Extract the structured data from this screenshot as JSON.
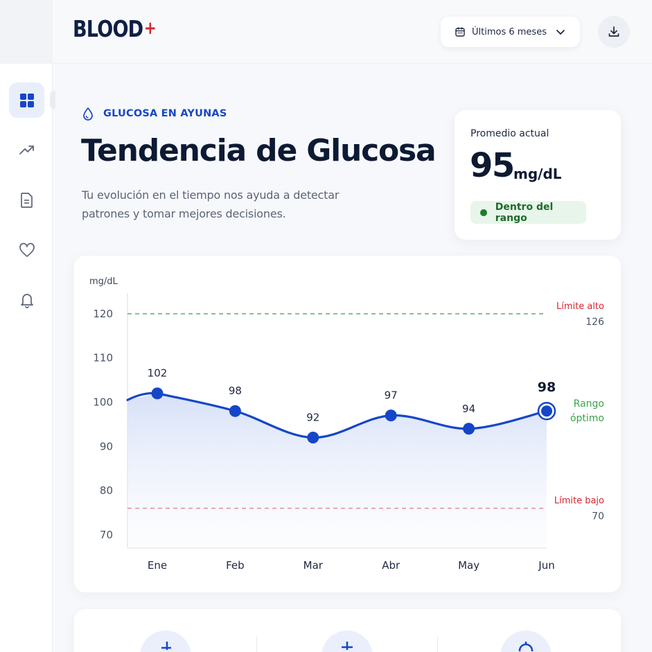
{
  "brand": {
    "logo_text": "BLOOD",
    "logo_plus": "+",
    "accent": "#d7262b",
    "navy": "#0f1f45"
  },
  "header": {
    "period_label": "Últimos 6 meses",
    "period_icon": "calendar-icon",
    "download_icon": "download-icon"
  },
  "sidebar": {
    "items": [
      {
        "name": "dashboard",
        "icon": "grid-icon",
        "active": true
      },
      {
        "name": "trends",
        "icon": "trend-up-icon",
        "active": false
      },
      {
        "name": "reports",
        "icon": "document-icon",
        "active": false
      },
      {
        "name": "health",
        "icon": "heart-icon",
        "active": false
      },
      {
        "name": "notifications",
        "icon": "bell-icon",
        "active": false
      }
    ]
  },
  "main": {
    "eyebrow": "GLUCOSA EN AYUNAS",
    "title": "Tendencia de Glucosa",
    "subtitle": "Tu evolución en el tiempo nos ayuda a detectar patrones y tomar mejores decisiones."
  },
  "average_card": {
    "label": "Promedio actual",
    "value": "95",
    "unit": "mg/dL",
    "status": "Dentro del rango",
    "status_color": "#1d7d2c"
  },
  "chart_data": {
    "type": "line",
    "ylabel": "mg/dL",
    "categories": [
      "Ene",
      "Feb",
      "Mar",
      "Abr",
      "May",
      "Jun"
    ],
    "series": [
      {
        "values": [
          102,
          98,
          92,
          97,
          94,
          98
        ],
        "color": "#1546c9"
      }
    ],
    "data_labels": [
      "102",
      "98",
      "92",
      "97",
      "94",
      "98"
    ],
    "yticks": [
      120,
      110,
      100,
      90,
      80,
      70
    ],
    "ylim": [
      67,
      125
    ],
    "highlight_last": true,
    "reference_lines": [
      {
        "label": "Límite alto",
        "value_label": "126",
        "y": 120,
        "color": "#3aa34a",
        "label_color": "#d7262b"
      },
      {
        "label": "Límite bajo",
        "value_label": "70",
        "y": 76,
        "color": "#e05a5a",
        "label_color": "#d7262b"
      }
    ],
    "range_label": [
      "Rango",
      "óptimo"
    ],
    "range_label_color": "#3aa34a",
    "grid": false
  },
  "bottom_stats": {
    "icons": [
      "stat-icon-1",
      "stat-icon-2",
      "stat-icon-3"
    ]
  }
}
